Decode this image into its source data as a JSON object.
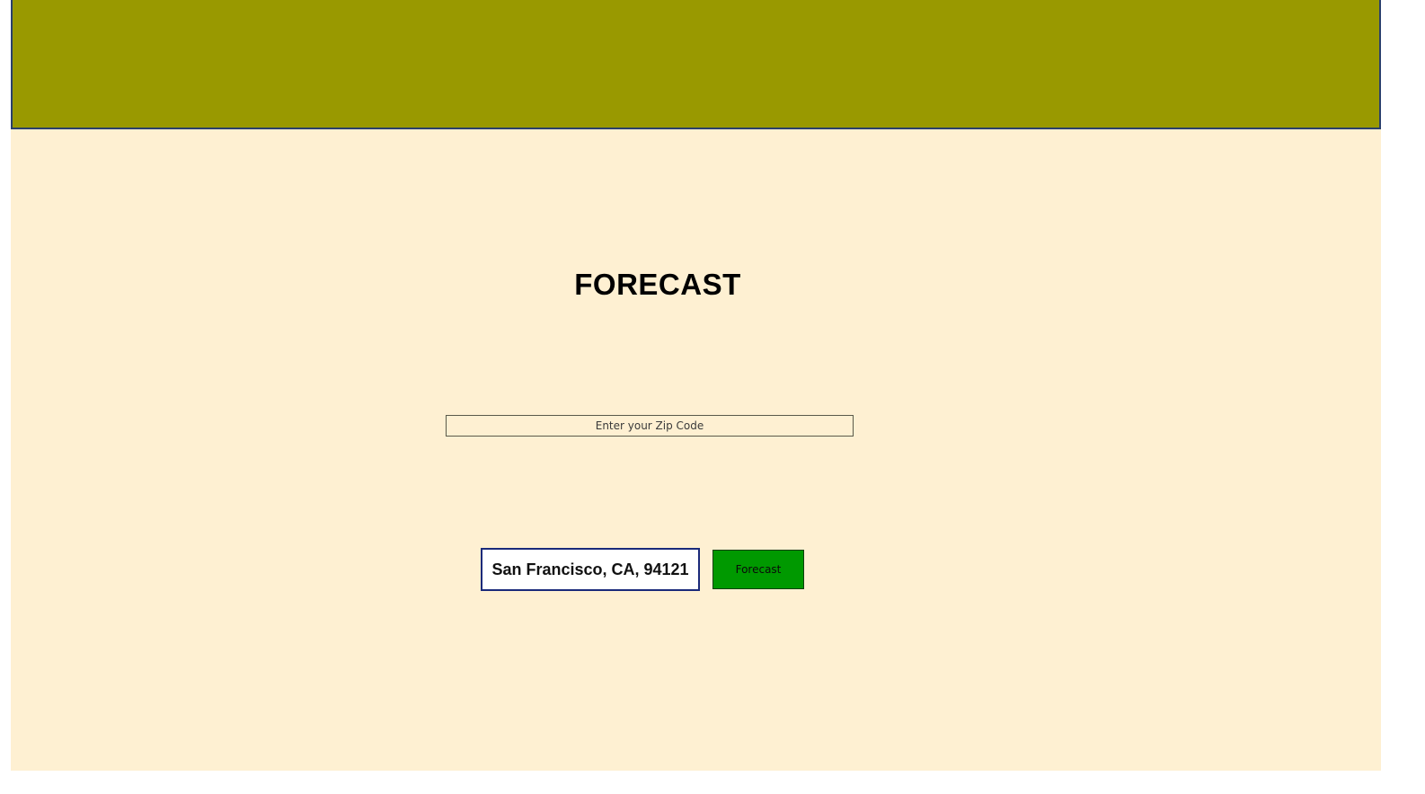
{
  "main": {
    "title": "FORECAST",
    "zip_input": {
      "placeholder": "Enter your Zip Code",
      "value": ""
    },
    "location_display": "San Francisco, CA, 94121",
    "forecast_button_label": "Forecast"
  },
  "colors": {
    "header_band": "#999900",
    "page_background": "#FEF0D2",
    "button": "#009900",
    "location_border": "#1a2a7a"
  }
}
